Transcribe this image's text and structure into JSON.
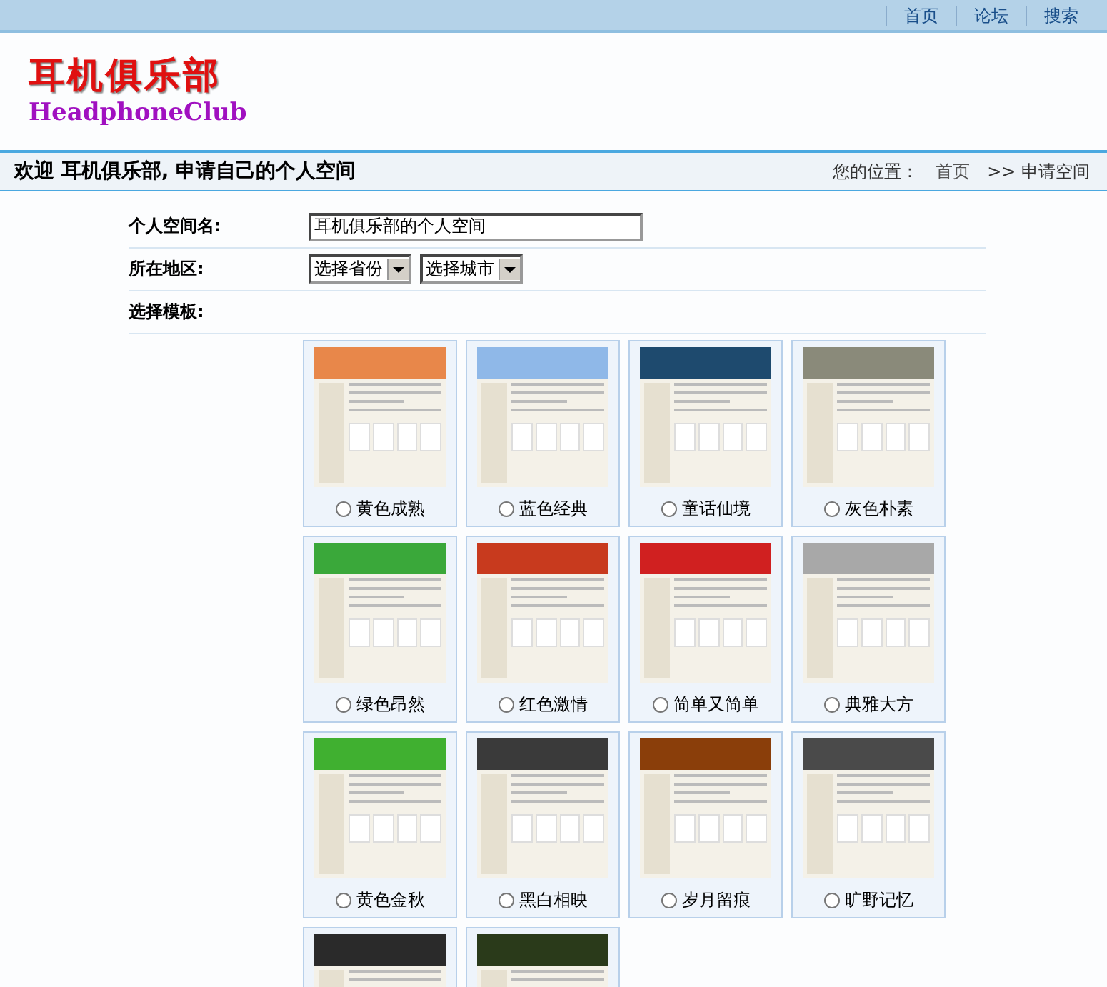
{
  "top_nav": [
    "首页",
    "论坛",
    "搜索"
  ],
  "logo": {
    "chinese": "耳机俱乐部",
    "english": "HeadphoneClub"
  },
  "title_bar": {
    "title": "欢迎  耳机俱乐部, 申请自己的个人空间",
    "location_label": "您的位置：",
    "breadcrumbs": [
      "首页",
      ">> 申请空间"
    ]
  },
  "form": {
    "space_name": {
      "label": "个人空间名:",
      "value": "耳机俱乐部的个人空间"
    },
    "region": {
      "label": "所在地区:",
      "province": "选择省份",
      "city": "选择城市"
    },
    "template": {
      "label": "选择模板:"
    }
  },
  "templates": [
    {
      "label": "黄色成熟",
      "color": "#e8874a",
      "selected": false
    },
    {
      "label": "蓝色经典",
      "color": "#8fb8e8",
      "selected": false
    },
    {
      "label": "童话仙境",
      "color": "#1e4a6e",
      "selected": false
    },
    {
      "label": "灰色朴素",
      "color": "#8a8a7a",
      "selected": false
    },
    {
      "label": "绿色昂然",
      "color": "#3aa83a",
      "selected": false
    },
    {
      "label": "红色激情",
      "color": "#c83a1e",
      "selected": false
    },
    {
      "label": "简单又简单",
      "color": "#d02020",
      "selected": false
    },
    {
      "label": "典雅大方",
      "color": "#a8a8a8",
      "selected": false
    },
    {
      "label": "黄色金秋",
      "color": "#40b030",
      "selected": false
    },
    {
      "label": "黑白相映",
      "color": "#3a3a3a",
      "selected": false
    },
    {
      "label": "岁月留痕",
      "color": "#8a3e0a",
      "selected": false
    },
    {
      "label": "旷野记忆",
      "color": "#4a4a4a",
      "selected": false
    },
    {
      "color": "#2a2a2a"
    },
    {
      "color": "#2a3a1a"
    }
  ]
}
